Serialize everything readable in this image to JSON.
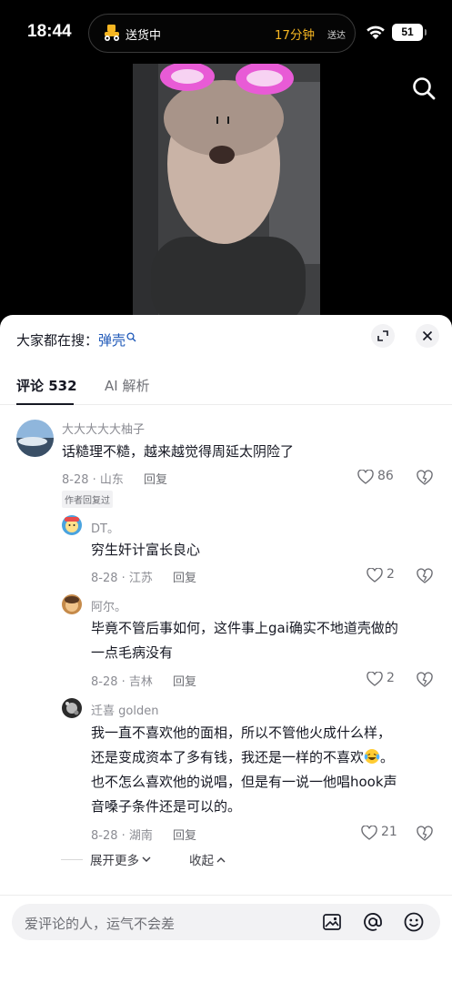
{
  "status_bar": {
    "time": "18:44",
    "delivery_status": "送货中",
    "eta": "17分钟",
    "eta_suffix": "送达",
    "battery": "51"
  },
  "video": {
    "icons": {
      "search": "search-icon"
    }
  },
  "sheet": {
    "trending_prefix": "大家都在搜：",
    "trending_keyword": "弹壳",
    "tabs": [
      {
        "label": "评论 532"
      },
      {
        "label": "AI 解析"
      }
    ],
    "comments": [
      {
        "user": "大大大大大柚子",
        "text": "话糙理不糙，越来越觉得周延太阴险了",
        "date_location": "8-28 · 山东",
        "reply_label": "回复",
        "likes": "86",
        "badge": "作者回复过"
      }
    ],
    "replies": [
      {
        "user": "DT。",
        "text": "穷生奸计富长良心",
        "date_location": "8-28 · 江苏",
        "reply_label": "回复",
        "likes": "2"
      },
      {
        "user": "阿尔。",
        "text_line1": "毕竟不管后事如何，这件事上gai确实不地道壳做的",
        "text_line2": "一点毛病没有",
        "date_location": "8-28 · 吉林",
        "reply_label": "回复",
        "likes": "2"
      },
      {
        "user": "迁喜 golden",
        "text_line1": "我一直不喜欢他的面相，所以不管他火成什么样，",
        "text_line2a": "还是变成资本了多有钱，我还是一样的不喜欢",
        "text_line2b": "。",
        "text_line3": "也不怎么喜欢他的说唱，但是有一说一他唱hook声",
        "text_line4": "音嗓子条件还是可以的。",
        "date_location": "8-28 · 湖南",
        "reply_label": "回复",
        "likes": "21"
      }
    ],
    "expand_more": "展开更多",
    "collapse": "收起"
  },
  "input": {
    "placeholder": "爱评论的人，运气不会差"
  },
  "colors": {
    "keyword_blue": "#1f59b8",
    "eta_yellow": "#f6b622",
    "text_primary": "#161823",
    "text_secondary": "#8b8c93"
  }
}
